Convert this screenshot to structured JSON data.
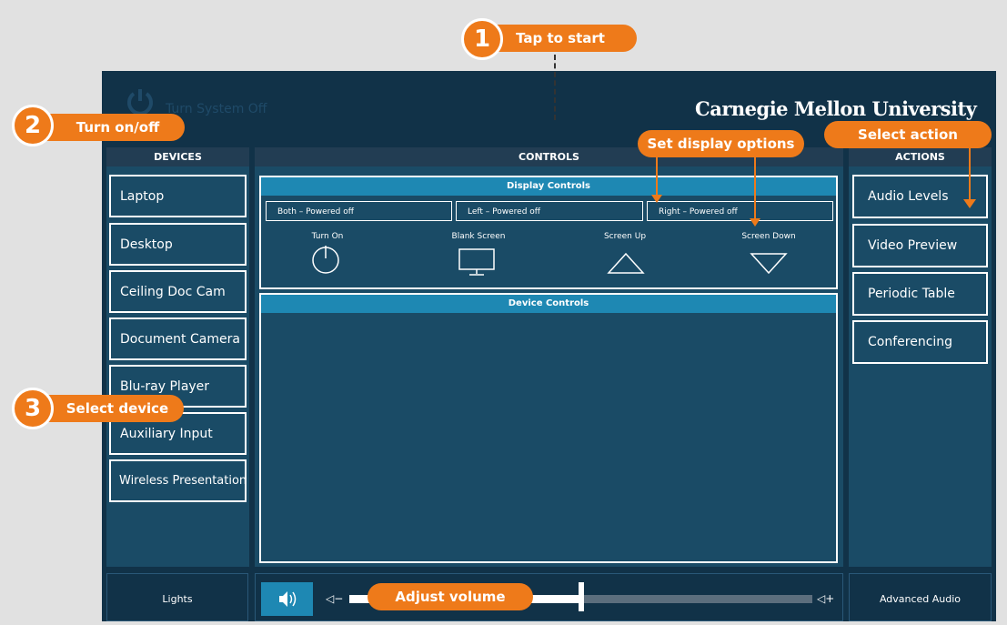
{
  "header": {
    "power_label": "Turn System Off",
    "brand": "Carnegie Mellon University"
  },
  "devices": {
    "title": "DEVICES",
    "items": [
      "Laptop",
      "Desktop",
      "Ceiling Doc Cam",
      "Document Camera",
      "Blu-ray Player",
      "Auxiliary Input",
      "Wireless Presentation"
    ]
  },
  "controls": {
    "title": "CONTROLS",
    "display_title": "Display Controls",
    "status": [
      "Both – Powered off",
      "Left – Powered off",
      "Right – Powered off"
    ],
    "buttons": [
      "Turn On",
      "Blank Screen",
      "Screen Up",
      "Screen Down"
    ],
    "device_title": "Device Controls"
  },
  "actions": {
    "title": "ACTIONS",
    "items": [
      "Audio Levels",
      "Video Preview",
      "Periodic Table",
      "Conferencing"
    ]
  },
  "bottom": {
    "lights": "Lights",
    "advanced_audio": "Advanced Audio",
    "volume_down": "◁−",
    "volume_up": "◁+",
    "volume_level": 0.5
  },
  "annotations": {
    "step1_num": "1",
    "step1_label": "Tap to start",
    "step2_num": "2",
    "step2_label": "Turn on/off",
    "step3_num": "3",
    "step3_label": "Select device",
    "display_options": "Set display options",
    "select_action": "Select action",
    "adjust_volume": "Adjust volume"
  },
  "colors": {
    "accent": "#ee7a1a",
    "panel": "#113248",
    "button_bg": "#1a4b66",
    "header_blue": "#1e88b3"
  }
}
